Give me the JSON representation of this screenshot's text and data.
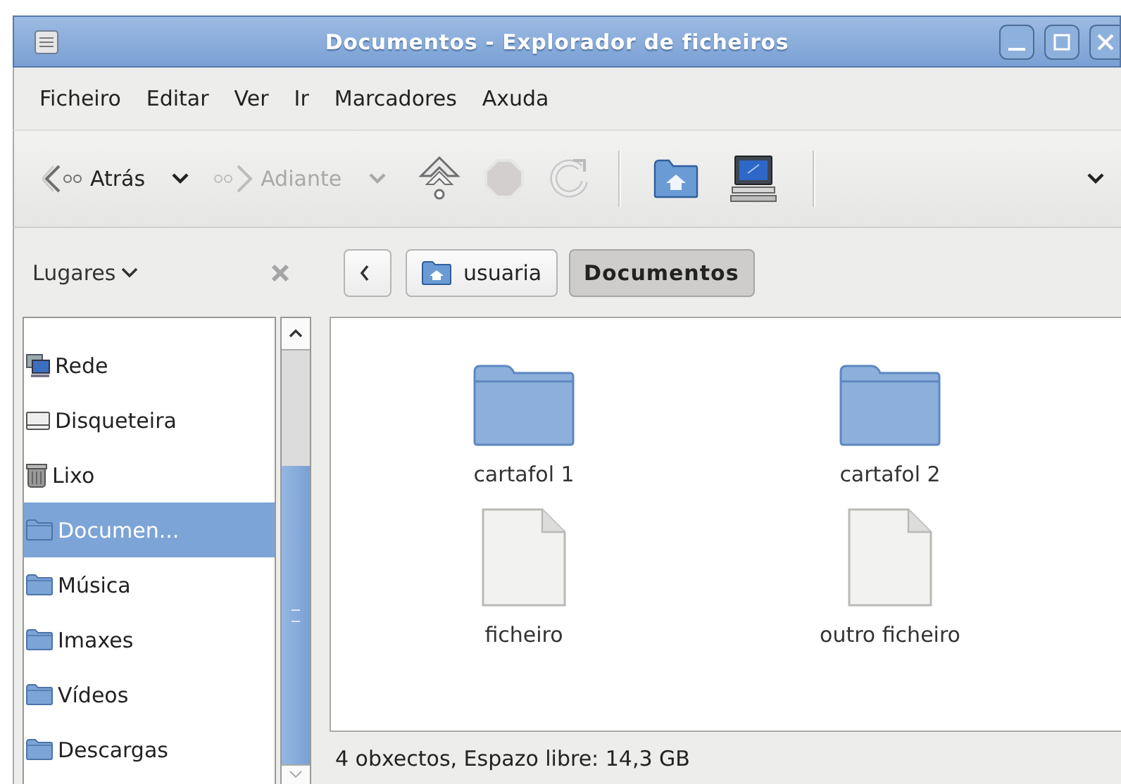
{
  "window": {
    "title": "Documentos - Explorador de ficheiros"
  },
  "menu": [
    "Ficheiro",
    "Editar",
    "Ver",
    "Ir",
    "Marcadores",
    "Axuda"
  ],
  "toolbar": [
    {
      "kind": "back",
      "label": "Atrás",
      "disabled": false
    },
    {
      "kind": "caret",
      "disabled": false
    },
    {
      "kind": "forward",
      "label": "Adiante",
      "disabled": true
    },
    {
      "kind": "caret",
      "disabled": true
    },
    {
      "kind": "up"
    },
    {
      "kind": "stop",
      "disabled": true
    },
    {
      "kind": "reload"
    },
    {
      "kind": "separator"
    },
    {
      "kind": "home"
    },
    {
      "kind": "computer"
    },
    {
      "kind": "separator"
    },
    {
      "kind": "overflow"
    }
  ],
  "sidebar": {
    "header": "Lugares",
    "items": [
      {
        "label": "Rede",
        "kind": "network",
        "selected": false
      },
      {
        "label": "Disqueteira",
        "kind": "drive",
        "selected": false
      },
      {
        "label": "Lixo",
        "kind": "trash",
        "selected": false
      },
      {
        "label": "Documen...",
        "kind": "folder",
        "selected": true
      },
      {
        "label": "Música",
        "kind": "folder",
        "selected": false
      },
      {
        "label": "Imaxes",
        "kind": "folder",
        "selected": false
      },
      {
        "label": "Vídeos",
        "kind": "folder",
        "selected": false
      },
      {
        "label": "Descargas",
        "kind": "folder",
        "selected": false
      }
    ]
  },
  "path": [
    {
      "label": "usuaria",
      "kind": "home",
      "selected": false
    },
    {
      "label": "Documentos",
      "kind": "plain",
      "selected": true
    }
  ],
  "files": [
    {
      "name": "cartafol 1",
      "kind": "folder"
    },
    {
      "name": "cartafol 2",
      "kind": "folder"
    },
    {
      "name": "ficheiro",
      "kind": "file"
    },
    {
      "name": "outro ficheiro",
      "kind": "file"
    }
  ],
  "status_bar": "4 obxectos, Espazo libre: 14,3 GB"
}
